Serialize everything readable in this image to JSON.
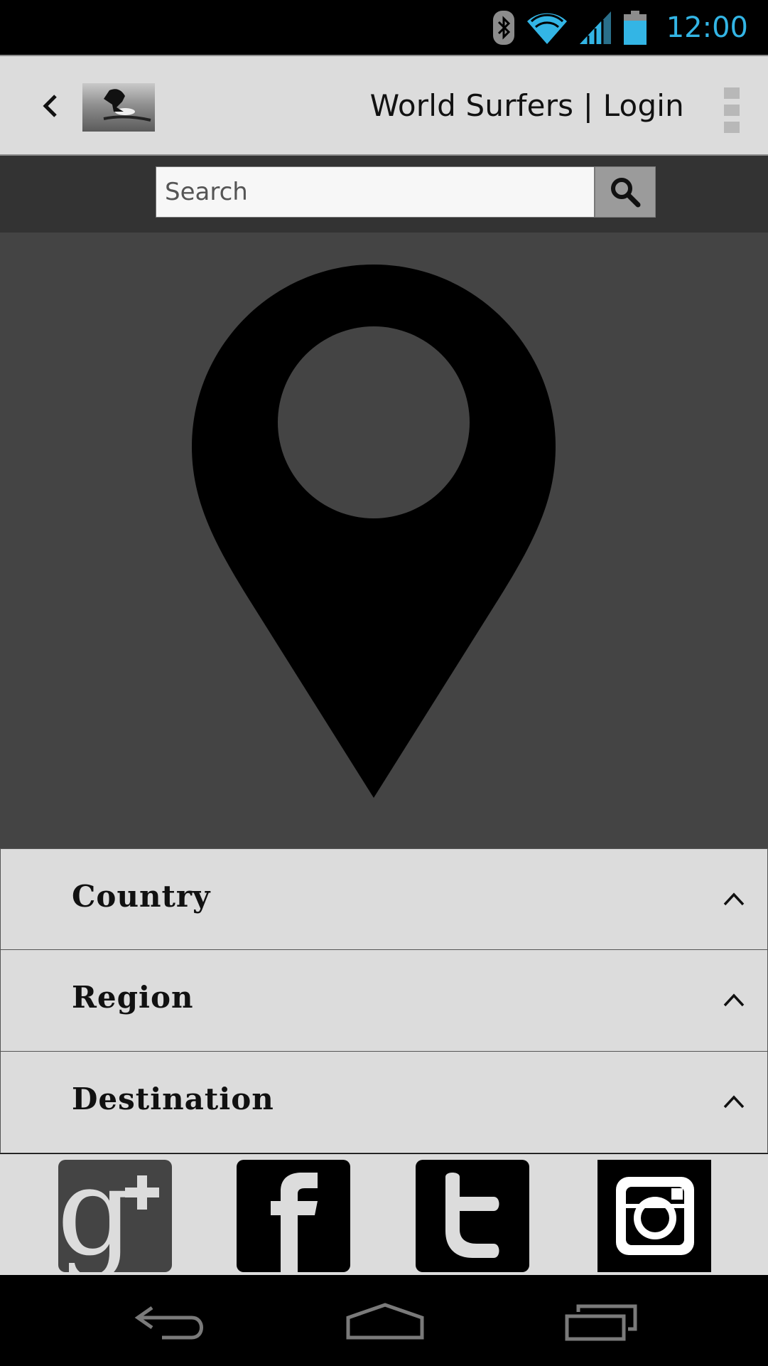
{
  "status_bar": {
    "time": "12:00",
    "icons": [
      "bluetooth-icon",
      "wifi-icon",
      "signal-icon",
      "battery-icon"
    ],
    "accent_color": "#33b5e5"
  },
  "app_bar": {
    "title": "World Surfers | Login",
    "back_icon": "chevron-left-icon",
    "menu_icon": "overflow-menu-icon"
  },
  "search": {
    "placeholder": "Search",
    "button_icon": "search-icon"
  },
  "map": {
    "marker_icon": "location-pin-icon"
  },
  "filters": [
    {
      "label": "Country"
    },
    {
      "label": "Region"
    },
    {
      "label": "Destination"
    }
  ],
  "social": [
    "google-plus-icon",
    "facebook-icon",
    "twitter-icon",
    "instagram-icon"
  ],
  "nav": [
    "back-nav-icon",
    "home-nav-icon",
    "recents-nav-icon"
  ]
}
